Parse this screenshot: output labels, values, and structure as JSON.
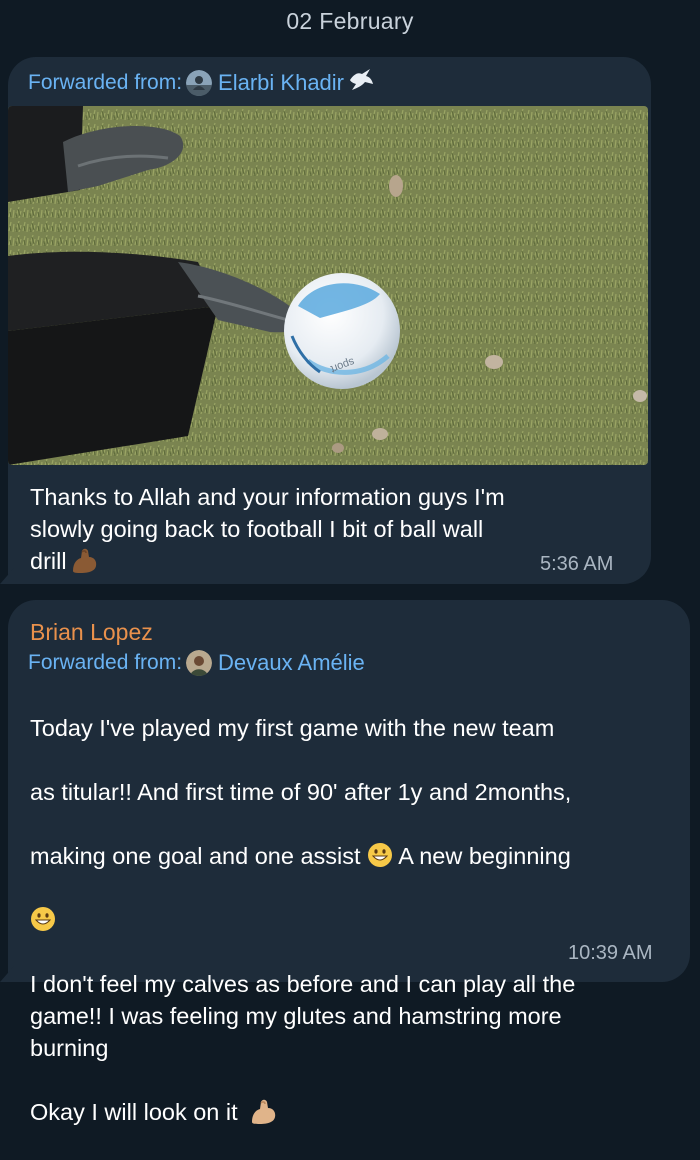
{
  "date_header": "02 February",
  "messages": [
    {
      "forwarded_label": "Forwarded from:",
      "forwarded_name": "Elarbi Khadir",
      "text": "Thanks to Allah and your information guys I'm\nslowly going back to football I bit of ball wall\ndrill",
      "time": "5:36 AM",
      "media": "photo",
      "photo_ball_print": "sport"
    },
    {
      "sender": "Brian Lopez",
      "forwarded_label": "Forwarded from:",
      "forwarded_name": "Devaux Amélie",
      "text_line1": "Today I've played my first game with the new team",
      "text_line2": "as titular!! And first time of 90' after 1y and 2months,",
      "text_line3a": "making one goal and one assist",
      "text_line3b": "A new beginning",
      "text_rest": "I don't feel my calves as before and I can play all the\ngame!! I was feeling my glutes and hamstring more\nburning\n\nOkay I will look on it",
      "time": "10:39 AM"
    }
  ],
  "colors": {
    "background": "#0f1a24",
    "bubble": "#1e2c3a",
    "link_blue": "#6ab3f3",
    "sender_orange": "#e9914c",
    "timestamp": "#aab6c2"
  },
  "icons": [
    "dove-icon",
    "flexed-biceps-emoji",
    "grinning-emoji"
  ]
}
